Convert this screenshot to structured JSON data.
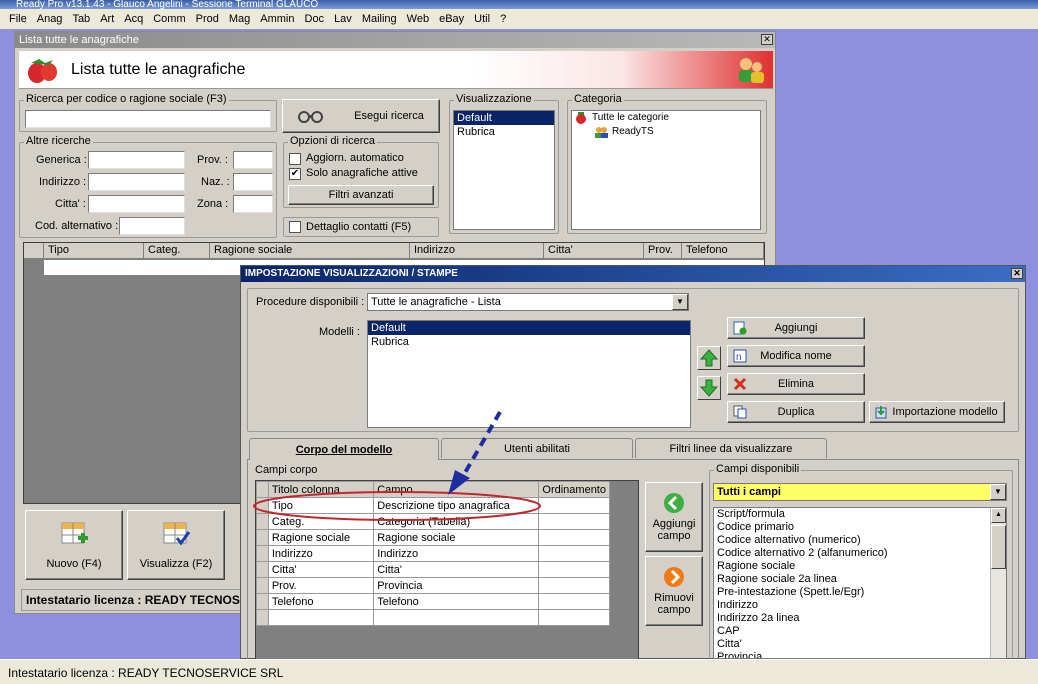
{
  "app": {
    "title": "Ready Pro v13.1.43 - Glauco Angelini - Sessione Terminal GLAUCO",
    "menu": [
      "File",
      "Anag",
      "Tab",
      "Art",
      "Acq",
      "Comm",
      "Prod",
      "Mag",
      "Ammin",
      "Doc",
      "Lav",
      "Mailing",
      "Web",
      "eBay",
      "Util",
      "?"
    ],
    "status": "Intestatario licenza : READY TECNOSERVICE SRL"
  },
  "win1": {
    "title": "Lista tutte le anagrafiche",
    "header_title": "Lista tutte le anagrafiche",
    "search_group": "Ricerca per codice o ragione sociale (F3)",
    "search_value": "",
    "search_button": "Esegui ricerca",
    "altre_group": "Altre ricerche",
    "labels": {
      "generica": "Generica :",
      "indirizzo": "Indirizzo :",
      "citta": "Citta' :",
      "cod_alt": "Cod. alternativo :",
      "prov": "Prov. :",
      "naz": "Naz. :",
      "zona": "Zona :"
    },
    "opzioni_group": "Opzioni di ricerca",
    "opt_aggiorn": "Aggiorn. automatico",
    "opt_aggiorn_checked": false,
    "opt_solo": "Solo anagrafiche attive",
    "opt_solo_checked": true,
    "filtri_button": "Filtri avanzati",
    "dettaglio": "Dettaglio contatti (F5)",
    "visualizzazione_group": "Visualizzazione",
    "visualizzazione_items": [
      "Default",
      "Rubrica"
    ],
    "categoria_group": "Categoria",
    "categoria_root": "Tutte le categorie",
    "categoria_child": "ReadyTS",
    "grid_columns": [
      "Tipo",
      "Categ.",
      "Ragione sociale",
      "Indirizzo",
      "Citta'",
      "Prov.",
      "Telefono"
    ],
    "btn_nuovo": "Nuovo (F4)",
    "btn_visualizza": "Visualizza (F2)",
    "status": "Intestatario licenza : READY TECNOS"
  },
  "win2": {
    "title": "IMPOSTAZIONE VISUALIZZAZIONI / STAMPE",
    "procedure_label": "Procedure disponibili :",
    "procedure_value": "Tutte le anagrafiche - Lista",
    "modelli_label": "Modelli :",
    "modelli": [
      "Default",
      "Rubrica"
    ],
    "btn_aggiungi": "Aggiungi",
    "btn_modifica": "Modifica nome",
    "btn_elimina": "Elimina",
    "btn_duplica": "Duplica",
    "btn_importazione": "Importazione modello",
    "tabs": [
      "Corpo del modello",
      "Utenti abilitati",
      "Filtri linee da visualizzare"
    ],
    "campi_corpo_label": "Campi corpo",
    "columns": [
      "Titolo colonna",
      "Campo",
      "Ordinamento"
    ],
    "rows": [
      {
        "titolo": "Tipo",
        "campo": "Descrizione tipo anagrafica"
      },
      {
        "titolo": "Categ.",
        "campo": "Categoria (Tabella)"
      },
      {
        "titolo": "Ragione sociale",
        "campo": "Ragione sociale"
      },
      {
        "titolo": "Indirizzo",
        "campo": "Indirizzo"
      },
      {
        "titolo": "Citta'",
        "campo": "Citta'"
      },
      {
        "titolo": "Prov.",
        "campo": "Provincia"
      },
      {
        "titolo": "Telefono",
        "campo": "Telefono"
      }
    ],
    "btn_aggiungi_campo": "Aggiungi campo",
    "btn_rimuovi_campo": "Rimuovi campo",
    "campi_disponibili_label": "Campi disponibili",
    "campi_filter": "Tutti i campi",
    "campi_disponibili": [
      "Script/formula",
      "Codice primario",
      "Codice alternativo (numerico)",
      "Codice alternativo 2 (alfanumerico)",
      "Ragione sociale",
      "Ragione sociale 2a linea",
      "Pre-intestazione (Spett.le/Egr)",
      "Indirizzo",
      "Indirizzo 2a linea",
      "CAP",
      "Citta'",
      "Provincia"
    ]
  },
  "colors": {
    "highlight": "#0a246a",
    "yellow": "#ffff66",
    "annotation_red": "#c0282e",
    "arrow_blue": "#1f2d9e"
  }
}
